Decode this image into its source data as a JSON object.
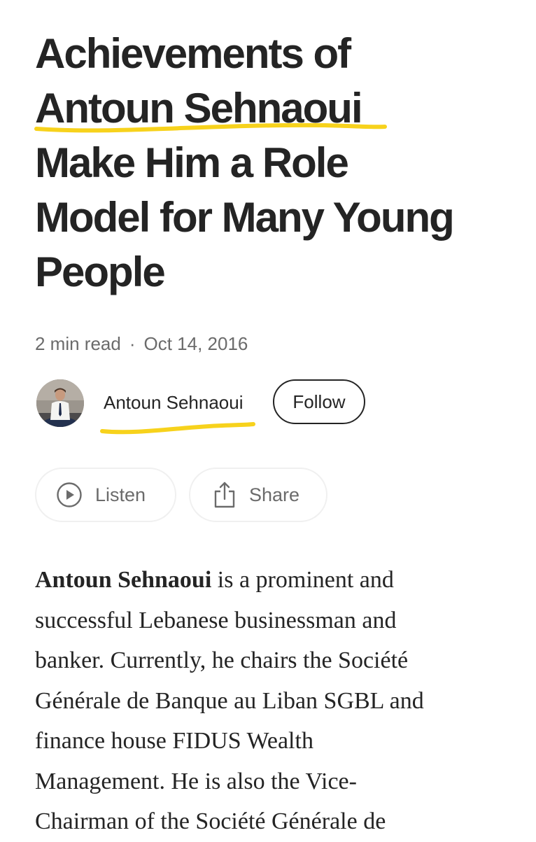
{
  "article": {
    "title_lines": [
      "Achievements of",
      "Antoun Sehnaoui",
      "Make Him a Role",
      "Model for Many Young",
      "People"
    ],
    "read_time": "2 min read",
    "separator": "·",
    "date": "Oct 14, 2016",
    "author_name": "Antoun Sehnaoui",
    "follow_label": "Follow",
    "listen_label": "Listen",
    "share_label": "Share",
    "body_lead_bold": "Antoun Sehnaoui",
    "body_lines": [
      " is a prominent and",
      "successful Lebanese businessman and",
      "banker. Currently, he chairs the Société",
      "Générale de Banque au Liban SGBL and",
      "finance house FIDUS Wealth",
      "Management. He is also the Vice-",
      "Chairman of the Société Générale de"
    ]
  },
  "colors": {
    "text": "#242424",
    "muted": "#6b6b6b",
    "highlight_marker": "#f7d21c",
    "button_border": "#f0f0f0"
  },
  "icons": {
    "listen": "play-circle-icon",
    "share": "share-icon"
  }
}
